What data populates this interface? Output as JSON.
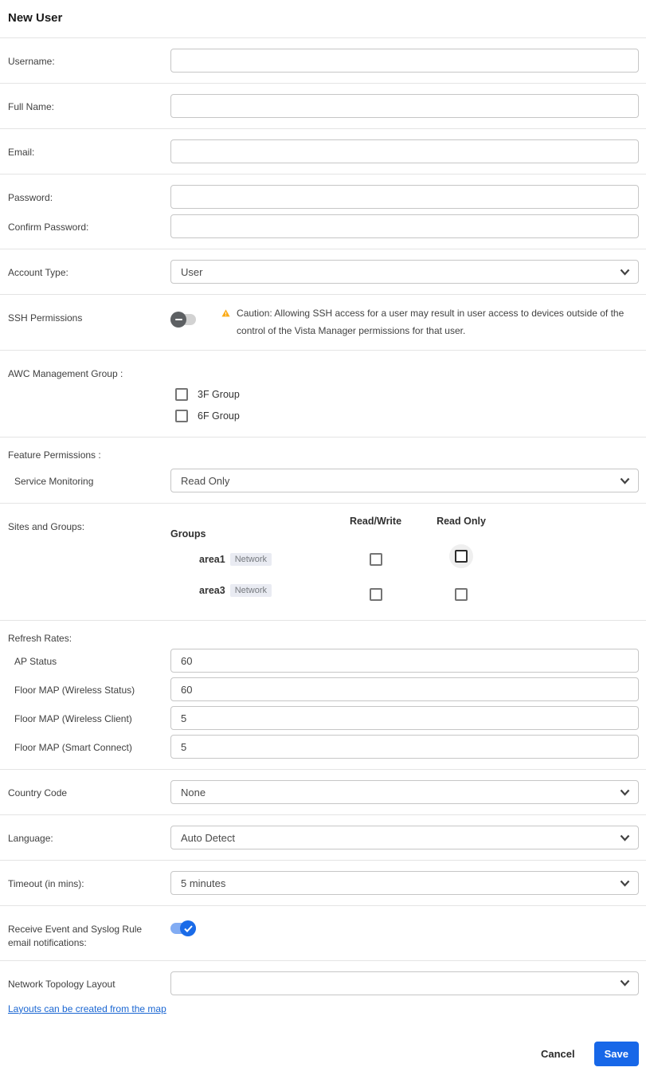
{
  "header": {
    "title": "New User"
  },
  "form": {
    "username": {
      "label": "Username:",
      "value": ""
    },
    "full_name": {
      "label": "Full Name:",
      "value": ""
    },
    "email": {
      "label": "Email:",
      "value": ""
    },
    "password": {
      "label": "Password:",
      "value": ""
    },
    "confirm_password": {
      "label": "Confirm Password:",
      "value": ""
    },
    "account_type": {
      "label": "Account Type:",
      "value": "User"
    },
    "ssh_permissions": {
      "label": "SSH Permissions",
      "toggle_state": "off",
      "warning": "Caution: Allowing SSH access for a user may result in user access to devices outside of the control of the Vista Manager permissions for that user."
    },
    "awc_management_group": {
      "label": "AWC Management Group :",
      "options": [
        {
          "label": "3F Group",
          "checked": false
        },
        {
          "label": "6F Group",
          "checked": false
        }
      ]
    },
    "feature_permissions": {
      "label": "Feature Permissions :",
      "service_monitoring": {
        "label": "Service Monitoring",
        "value": "Read Only"
      }
    },
    "sites_and_groups": {
      "label": "Sites and Groups:",
      "columns": {
        "groups": "Groups",
        "read_write": "Read/Write",
        "read_only": "Read Only"
      },
      "rows": [
        {
          "name": "area1",
          "badge": "Network",
          "read_write_checked": false,
          "read_only_checked": false,
          "read_only_focused": true
        },
        {
          "name": "area3",
          "badge": "Network",
          "read_write_checked": false,
          "read_only_checked": false,
          "read_only_focused": false
        }
      ]
    },
    "refresh_rates": {
      "label": "Refresh Rates:",
      "items": [
        {
          "label": "AP Status",
          "value": "60"
        },
        {
          "label": "Floor MAP (Wireless Status)",
          "value": "60"
        },
        {
          "label": "Floor MAP (Wireless Client)",
          "value": "5"
        },
        {
          "label": "Floor MAP (Smart Connect)",
          "value": "5"
        }
      ]
    },
    "country_code": {
      "label": "Country Code",
      "value": "None"
    },
    "language": {
      "label": "Language:",
      "value": "Auto Detect"
    },
    "timeout": {
      "label": "Timeout (in mins):",
      "value": "5 minutes"
    },
    "email_notifications": {
      "label": "Receive Event and Syslog Rule email notifications:",
      "toggle_state": "on"
    },
    "network_topology_layout": {
      "label": "Network Topology Layout",
      "value": "",
      "link": "Layouts can be created from the map"
    }
  },
  "actions": {
    "cancel": "Cancel",
    "save": "Save"
  },
  "colors": {
    "accent_blue": "#1767e8",
    "toggle_on_knob": "#1a6be8",
    "toggle_on_track": "#82acf3",
    "toggle_off_knob": "#5d6063",
    "warning_orange": "#fbab18",
    "link_blue": "#1a66d2",
    "badge_bg": "#e9ebf2"
  }
}
